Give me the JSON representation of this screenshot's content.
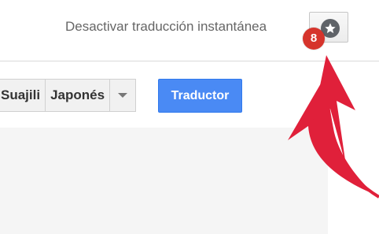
{
  "header": {
    "instant_translation_toggle": "Desactivar traducción instantánea",
    "star_badge_count": "8"
  },
  "toolbar": {
    "languages": [
      "Suajili",
      "Japonés"
    ],
    "translate_button": "Traductor"
  },
  "icons": {
    "star": "star-icon",
    "dropdown": "chevron-down-icon",
    "annotation_arrow": "arrow-annotation"
  },
  "colors": {
    "accent_blue": "#4a8af4",
    "badge_red": "#d6342c",
    "annotation_red": "#e0203a"
  }
}
